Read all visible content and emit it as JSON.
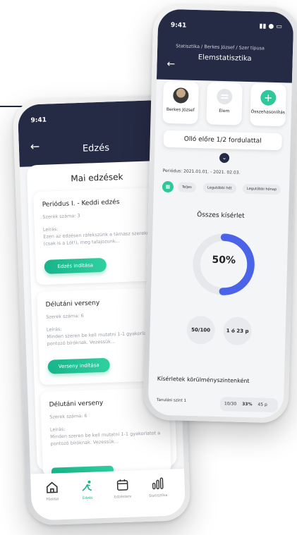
{
  "colors": {
    "header": "#262b45",
    "accent_green": "#18b48a",
    "donut_blue": "#4a63e8",
    "donut_track": "#e6e8ec"
  },
  "phone1": {
    "status_time": "9:41",
    "title": "Edzés",
    "back_icon": "arrow-left-icon",
    "panel_title": "Mai edzések",
    "cards": [
      {
        "title": "Periódus I. - Keddi edzés",
        "sub": "Szerek száma: 3",
        "label": "Leírás:",
        "desc": "Ezen az edzésen ráfekszünk a támasz szerekre (csak is a Lót!), meg talajozunk...",
        "button": "Edzés indítása"
      },
      {
        "title": "Délutáni verseny",
        "sub": "Szerek száma: 6",
        "label": "Leírás:",
        "desc": "Minden szeren be kell mutatni 1-1 gyakorlatot a pontozó bíróknak. Vezessük...",
        "button": "Verseny indítása"
      },
      {
        "title": "Délutáni verseny",
        "sub": "Szerek száma: 6",
        "label": "Leírás:",
        "desc": "Minden szeren be kell mutatni 1-1 gyakorlatot a pontozó bíróknak. Vezessük...",
        "button": ""
      }
    ],
    "tabs": [
      {
        "label": "Főoldal",
        "icon": "home-icon"
      },
      {
        "label": "Edzés",
        "icon": "gymnast-icon"
      },
      {
        "label": "Edzésterv",
        "icon": "calendar-icon"
      },
      {
        "label": "Statisztika",
        "icon": "bar-chart-icon"
      }
    ]
  },
  "phone2": {
    "status_time": "9:41",
    "breadcrumb": "Statisztika / Berkes József / Szer típusa",
    "title": "Elemstatisztika",
    "selectors": [
      {
        "label": "Berkes József",
        "icon": "avatar"
      },
      {
        "label": "Elem",
        "icon": "apparatus-icon"
      },
      {
        "label": "Összehasonlítás",
        "icon": "plus-icon"
      }
    ],
    "element_select": "Olló előre 1/2 fordulattal",
    "period": "Periódus: 2021.01.01. - 2021. 02.03.",
    "filters": [
      "Teljes",
      "Legutóbbi hét",
      "Legutóbbi hónap"
    ],
    "attempts_title": "Összes kísérlet",
    "percent_label": "50%",
    "percent_value": 50,
    "stat_count": "50/100",
    "stat_time": "1 ó 23 p",
    "conditions_title": "Kísérletek körülményszintenként",
    "condition_row": {
      "level": "Tanulási szint 1",
      "count": "10/30",
      "percent": "33%",
      "time": "45 p"
    }
  }
}
